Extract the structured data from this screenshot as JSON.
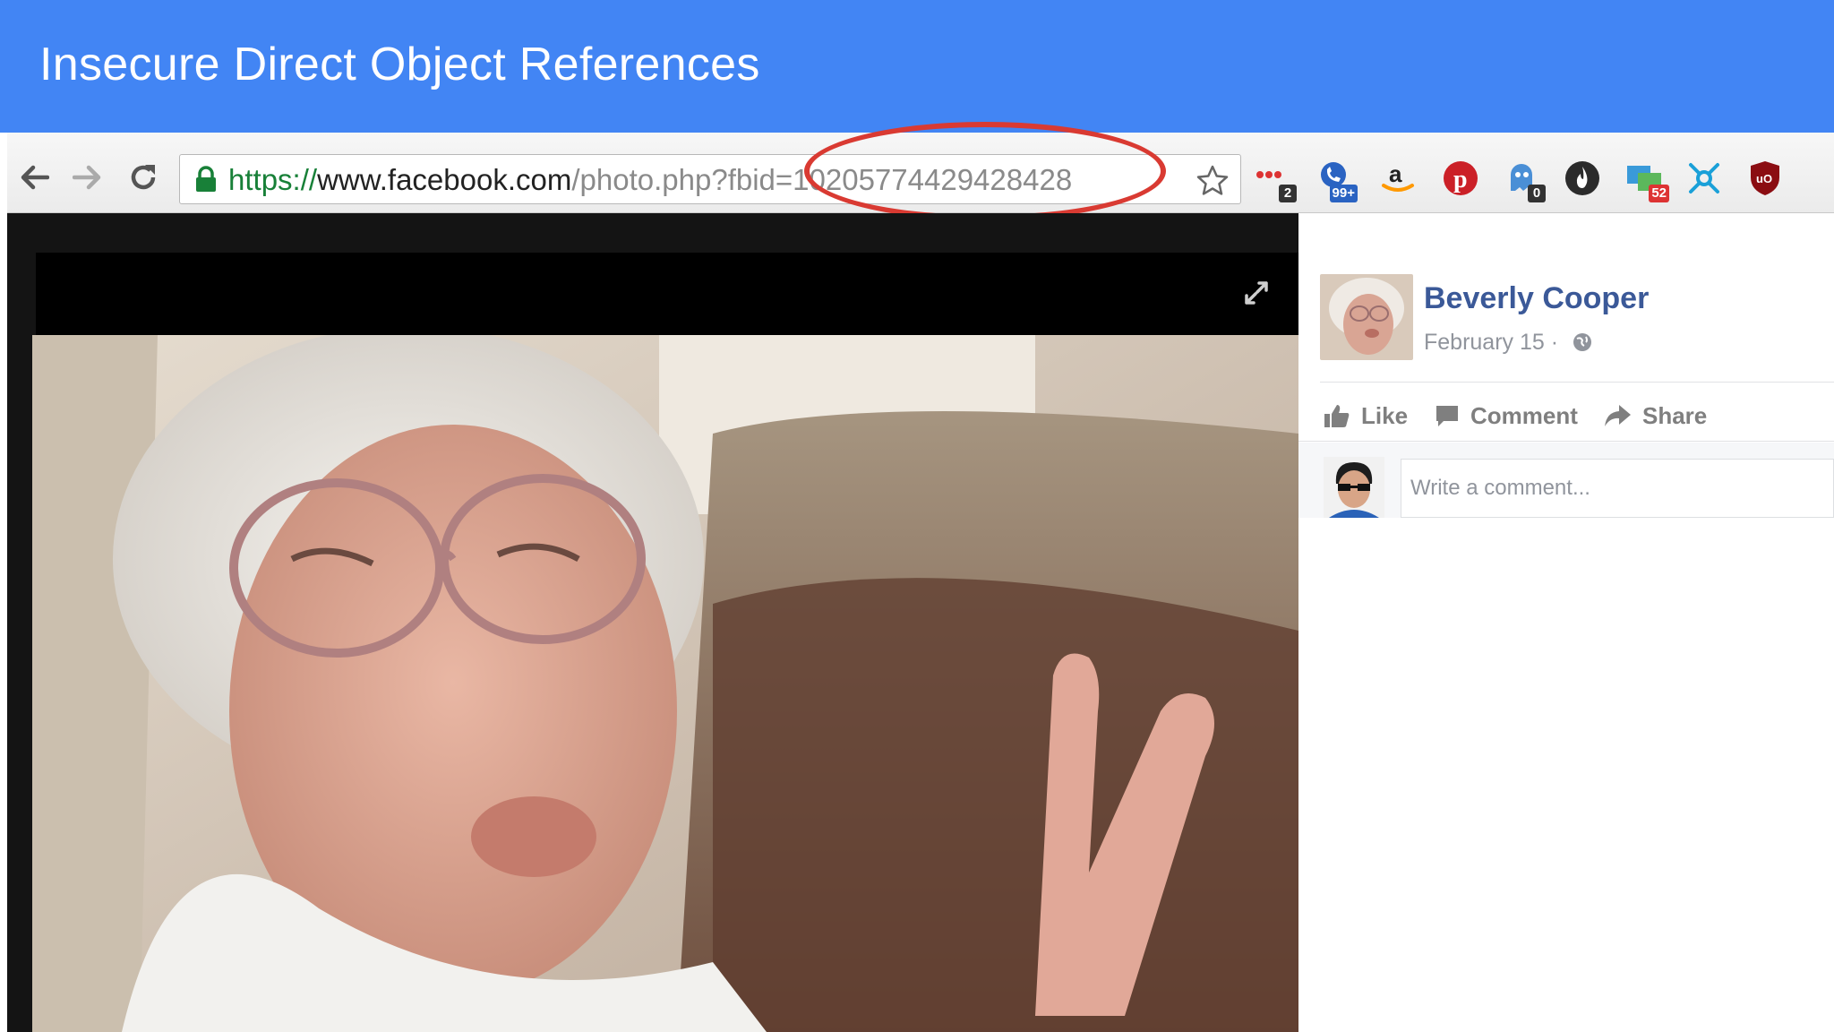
{
  "slide": {
    "title": "Insecure Direct Object References"
  },
  "browser": {
    "url": {
      "scheme": "https://",
      "host": "www.facebook.com",
      "path": "/photo.php?fbid=",
      "object_id": "10205774429428428"
    },
    "icons": {
      "back": "arrow-left-icon",
      "forward": "arrow-right-icon",
      "reload": "reload-icon",
      "lock": "lock-icon",
      "bookmark": "star-icon"
    },
    "extensions": [
      {
        "name": "dots-extension-icon",
        "badge": "2"
      },
      {
        "name": "phone-extension-icon",
        "badge": "99+"
      },
      {
        "name": "amazon-icon",
        "badge": ""
      },
      {
        "name": "pinterest-icon",
        "badge": ""
      },
      {
        "name": "ghostery-icon",
        "badge": "0"
      },
      {
        "name": "flame-icon",
        "badge": ""
      },
      {
        "name": "screens-extension-icon",
        "badge": "52"
      },
      {
        "name": "network-extension-icon",
        "badge": ""
      },
      {
        "name": "ublock-icon",
        "badge": ""
      }
    ]
  },
  "colors": {
    "header": "#4285f4",
    "annotation": "#d93a32",
    "facebook_blue": "#3b5998"
  },
  "post": {
    "author": "Beverly Cooper",
    "date": "February 15 ·",
    "actions": {
      "like": "Like",
      "comment": "Comment",
      "share": "Share"
    },
    "comment_placeholder": "Write a comment..."
  }
}
